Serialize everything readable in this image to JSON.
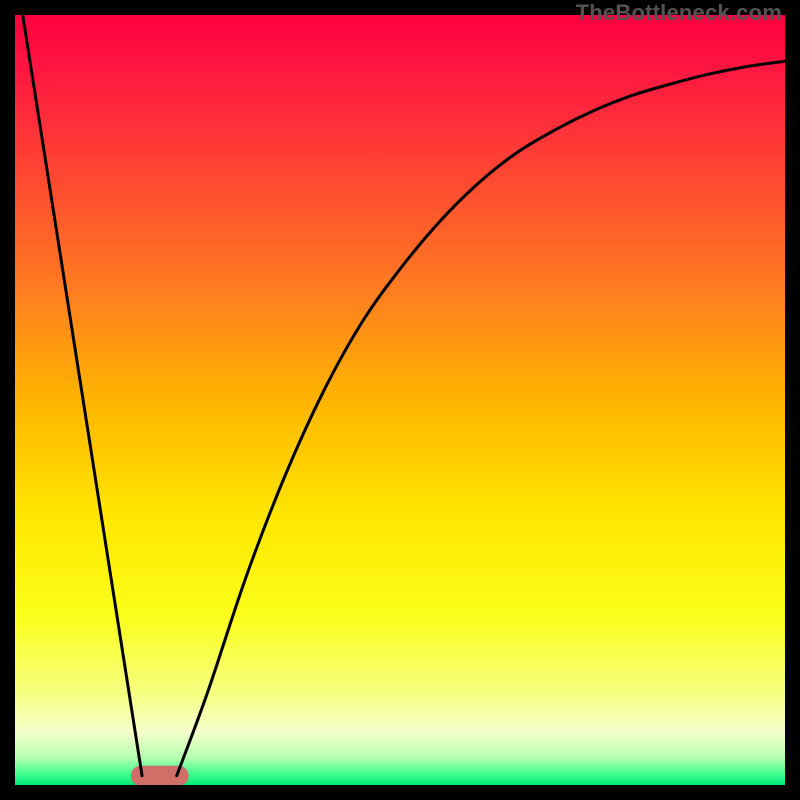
{
  "watermark": "TheBottleneck.com",
  "chart_data": {
    "type": "line",
    "title": "",
    "xlabel": "",
    "ylabel": "",
    "xlim": [
      0,
      100
    ],
    "ylim": [
      0,
      100
    ],
    "grid": false,
    "legend": false,
    "background_gradient": {
      "stops": [
        {
          "offset": 0.0,
          "color": "#ff0040"
        },
        {
          "offset": 0.08,
          "color": "#ff1a40"
        },
        {
          "offset": 0.2,
          "color": "#ff4433"
        },
        {
          "offset": 0.35,
          "color": "#ff7a22"
        },
        {
          "offset": 0.5,
          "color": "#ffb400"
        },
        {
          "offset": 0.65,
          "color": "#ffe600"
        },
        {
          "offset": 0.78,
          "color": "#fbff1a"
        },
        {
          "offset": 0.88,
          "color": "#f6ff80"
        },
        {
          "offset": 0.93,
          "color": "#f7ffcc"
        },
        {
          "offset": 0.965,
          "color": "#b5ffb0"
        },
        {
          "offset": 0.985,
          "color": "#40ff90"
        },
        {
          "offset": 1.0,
          "color": "#00e878"
        }
      ]
    },
    "series": [
      {
        "name": "left-branch",
        "type": "line",
        "x": [
          1.0,
          16.5
        ],
        "y": [
          100,
          1.2
        ]
      },
      {
        "name": "right-branch",
        "type": "curve",
        "x": [
          21,
          25,
          30,
          35,
          40,
          45,
          50,
          55,
          60,
          65,
          70,
          75,
          80,
          85,
          90,
          95,
          100
        ],
        "y": [
          1.2,
          12,
          27,
          40,
          51,
          60,
          67,
          73,
          78,
          82,
          85,
          87.5,
          89.5,
          91,
          92.3,
          93.3,
          94
        ]
      }
    ],
    "marker": {
      "name": "optimal-zone",
      "shape": "rounded-rect",
      "x_center": 18.8,
      "y_center": 1.2,
      "width": 7.5,
      "height": 2.6,
      "color": "#cf6f68"
    }
  }
}
